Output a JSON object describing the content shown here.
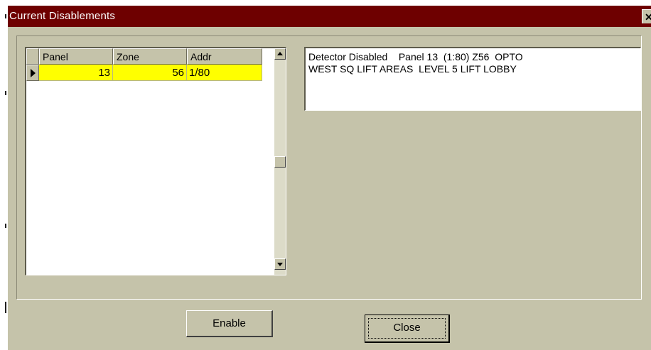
{
  "window": {
    "title": "Current Disablements",
    "close_glyph": "✕"
  },
  "grid": {
    "columns": [
      "Panel",
      "Zone",
      "Addr"
    ],
    "rows": [
      {
        "panel": "13",
        "zone": "56",
        "addr": "1/80",
        "highlight_color": "#ffff00"
      }
    ]
  },
  "details": {
    "line1": "Detector Disabled    Panel 13  (1:80) Z56  OPTO",
    "line2": "WEST SQ LIFT AREAS  LEVEL 5 LIFT LOBBY"
  },
  "buttons": {
    "enable_label": "Enable",
    "close_label": "Close"
  },
  "colors": {
    "titlebar": "#6e0000",
    "window_bg": "#c5c3aa"
  }
}
